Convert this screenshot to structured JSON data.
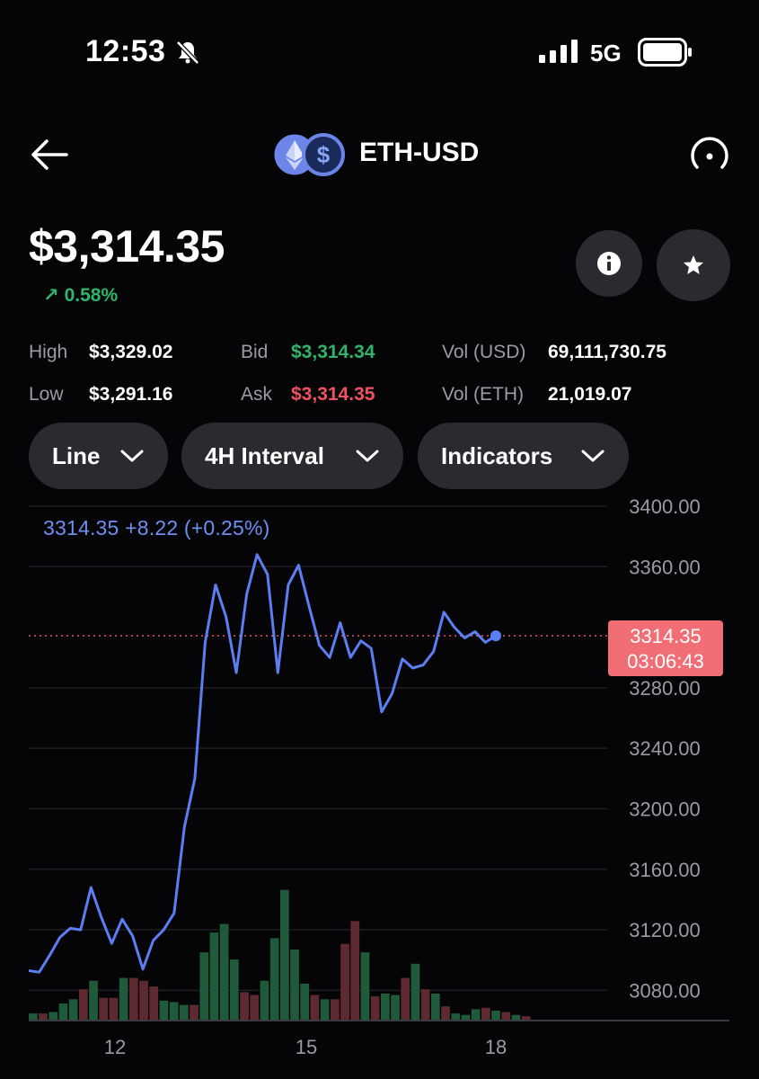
{
  "status_bar": {
    "time": "12:53",
    "network": "5G"
  },
  "header": {
    "pair": "ETH-USD"
  },
  "price": {
    "value": "$3,314.35",
    "change": "0.58%",
    "change_arrow": "↗"
  },
  "stats": {
    "high_label": "High",
    "high": "$3,329.02",
    "low_label": "Low",
    "low": "$3,291.16",
    "bid_label": "Bid",
    "bid": "$3,314.34",
    "ask_label": "Ask",
    "ask": "$3,314.35",
    "vol_usd_label": "Vol (USD)",
    "vol_usd": "69,111,730.75",
    "vol_eth_label": "Vol (ETH)",
    "vol_eth": "21,019.07"
  },
  "controls": {
    "chart_type": "Line",
    "interval": "4H Interval",
    "indicators": "Indicators"
  },
  "colors": {
    "line": "#5b7ff0",
    "up": "#1f5a3a",
    "down": "#5e2a30",
    "green_text": "#2fb56b",
    "red_text": "#ef5360",
    "tag": "#f06e74"
  },
  "chart_data": {
    "type": "line",
    "readout": "3314.35 +8.22 (+0.25%)",
    "current_tag": {
      "price": "3314.35",
      "countdown": "03:06:43"
    },
    "y_ticks": [
      "3400.00",
      "3360.00",
      "3280.00",
      "3240.00",
      "3200.00",
      "3160.00",
      "3120.00",
      "3080.00"
    ],
    "x_ticks": [
      "12",
      "15",
      "18"
    ],
    "ylim": [
      3060,
      3400
    ],
    "current_price": 3314.35,
    "series": [
      {
        "values": [
          3093,
          3092,
          3103,
          3115,
          3121,
          3120,
          3148,
          3128,
          3111,
          3127,
          3116,
          3094,
          3113,
          3120,
          3131,
          3188,
          3220,
          3310,
          3348,
          3327,
          3290,
          3342,
          3368,
          3355,
          3290,
          3348,
          3361,
          3334,
          3308,
          3300,
          3323,
          3300,
          3311,
          3306,
          3264,
          3276,
          3299,
          3293,
          3295,
          3304,
          3330,
          3320,
          3313,
          3317,
          3310,
          3314.35
        ]
      }
    ],
    "volume": [
      {
        "v": 5,
        "up": true
      },
      {
        "v": 5,
        "up": false
      },
      {
        "v": 6,
        "up": true
      },
      {
        "v": 12,
        "up": true
      },
      {
        "v": 15,
        "up": true
      },
      {
        "v": 22,
        "up": false
      },
      {
        "v": 28,
        "up": true
      },
      {
        "v": 16,
        "up": false
      },
      {
        "v": 16,
        "up": false
      },
      {
        "v": 30,
        "up": true
      },
      {
        "v": 30,
        "up": false
      },
      {
        "v": 28,
        "up": false
      },
      {
        "v": 24,
        "up": false
      },
      {
        "v": 14,
        "up": true
      },
      {
        "v": 13,
        "up": true
      },
      {
        "v": 11,
        "up": true
      },
      {
        "v": 11,
        "up": false
      },
      {
        "v": 48,
        "up": true
      },
      {
        "v": 62,
        "up": true
      },
      {
        "v": 68,
        "up": true
      },
      {
        "v": 43,
        "up": true
      },
      {
        "v": 20,
        "up": false
      },
      {
        "v": 18,
        "up": false
      },
      {
        "v": 28,
        "up": true
      },
      {
        "v": 58,
        "up": true
      },
      {
        "v": 92,
        "up": true
      },
      {
        "v": 50,
        "up": true
      },
      {
        "v": 26,
        "up": true
      },
      {
        "v": 18,
        "up": false
      },
      {
        "v": 15,
        "up": true
      },
      {
        "v": 15,
        "up": false
      },
      {
        "v": 54,
        "up": false
      },
      {
        "v": 70,
        "up": false
      },
      {
        "v": 48,
        "up": true
      },
      {
        "v": 17,
        "up": false
      },
      {
        "v": 19,
        "up": true
      },
      {
        "v": 18,
        "up": true
      },
      {
        "v": 30,
        "up": false
      },
      {
        "v": 40,
        "up": true
      },
      {
        "v": 22,
        "up": false
      },
      {
        "v": 19,
        "up": true
      },
      {
        "v": 10,
        "up": false
      },
      {
        "v": 5,
        "up": true
      },
      {
        "v": 4,
        "up": true
      },
      {
        "v": 8,
        "up": true
      },
      {
        "v": 9,
        "up": false
      },
      {
        "v": 7,
        "up": true
      },
      {
        "v": 6,
        "up": false
      },
      {
        "v": 4,
        "up": true
      },
      {
        "v": 3,
        "up": false
      }
    ]
  }
}
